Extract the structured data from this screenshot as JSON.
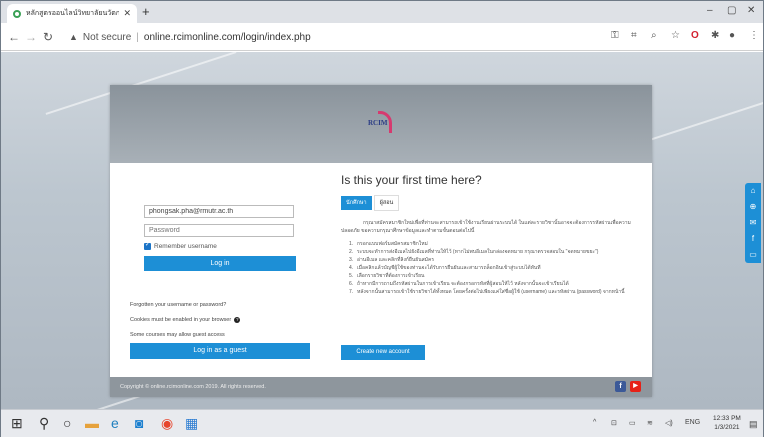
{
  "browser": {
    "tab_title": "หลักสูตรออนไลน์วิทยาลัยนวัตกรรมการ",
    "tab_close": "✕",
    "new_tab": "+",
    "not_secure": "Not secure",
    "url": "online.rcimonline.com/login/index.php",
    "window_controls": [
      "–",
      "▢",
      "✕"
    ],
    "toolbar_icons": [
      "key-icon",
      "translate-icon",
      "zoom-icon",
      "star-icon",
      "opera-icon",
      "extensions-icon",
      "profile-icon",
      "menu-icon"
    ]
  },
  "site": {
    "logo_text": "RCIM",
    "login": {
      "username_value": "phongsak.pha@rmutr.ac.th",
      "password_placeholder": "Password",
      "remember_label": "Remember username",
      "remember_checked": true,
      "login_button": "Log in",
      "forgot_link": "Forgotten your username or password?",
      "cookies_text": "Cookies must be enabled in your browser",
      "guest_text": "Some courses may allow guest access",
      "guest_button": "Log in as a guest"
    },
    "first_time": {
      "heading": "Is this your first time here?",
      "tabs": [
        "นักศึกษา",
        "ผู้สอน"
      ],
      "intro": "กรุณาสมัครสมาชิกใหม่เพื่อที่ท่านจะสามารถเข้าใช้งานเรียนผ่านระบบได้ ในแต่ละรายวิชานั้นอาจจะต้องการรหัสผ่านเพื่อความปลอดภัย ขอความกรุณาศึกษาข้อมูลและทำตามขั้นตอนต่อไปนี้",
      "steps": [
        {
          "n": "1.",
          "text": "กรอกแบบฟอร์มสมัครสมาชิกใหม่"
        },
        {
          "n": "2.",
          "text": "ระบบจะทำการส่งอีเมลไปยังอีเมลที่ท่านให้ไว้ (หากไม่พบอีเมลในกล่องจดหมาย กรุณาตรวจสอบใน \"จดหมายขยะ\")"
        },
        {
          "n": "3.",
          "text": "อ่านอีเมล และคลิกที่ลิงก์ยืนยันสมัคร"
        },
        {
          "n": "4.",
          "text": "เมื่อคลิกแล้วบัญชีผู้ใช้ของท่านจะได้รับการยืนยันและสามารถล็อกอินเข้าสู่ระบบได้ทันที"
        },
        {
          "n": "5.",
          "text": "เลือกรายวิชาที่ต้องการเข้าเรียน"
        },
        {
          "n": "6.",
          "text": "ถ้าหากมีการถามถึงรหัสผ่านในการเข้าเรียน จะต้องกรอกรหัสที่ผู้สอนให้ไว้ หลังจากนั้นจะเข้าเรียนได้"
        },
        {
          "n": "7.",
          "text": "หลังจากนั้นสามารถเข้าใช้รายวิชาได้ทั้งหมด โดยครั้งต่อไปเพียงแค่ใส่ชื่อผู้ใช้ (username) และรหัสผ่าน (password) จากหน้านี้"
        }
      ],
      "create_button": "Create new account"
    },
    "footer": "Copyright © online.rcimonline.com 2019. All rights reserved.",
    "social": [
      {
        "name": "facebook-icon",
        "glyph": "f",
        "color": "#3b5998"
      },
      {
        "name": "youtube-icon",
        "glyph": "▶",
        "color": "#e62117"
      }
    ],
    "side_icons": [
      "home-icon",
      "add-icon",
      "mail-icon",
      "facebook-icon",
      "mobile-icon"
    ]
  },
  "taskbar": {
    "time": "12:33 PM",
    "date": "1/3/2021",
    "lang": "ENG"
  },
  "colors": {
    "accent": "#1d8fd6",
    "banner": "#8a939b",
    "footer": "#8e969d"
  }
}
